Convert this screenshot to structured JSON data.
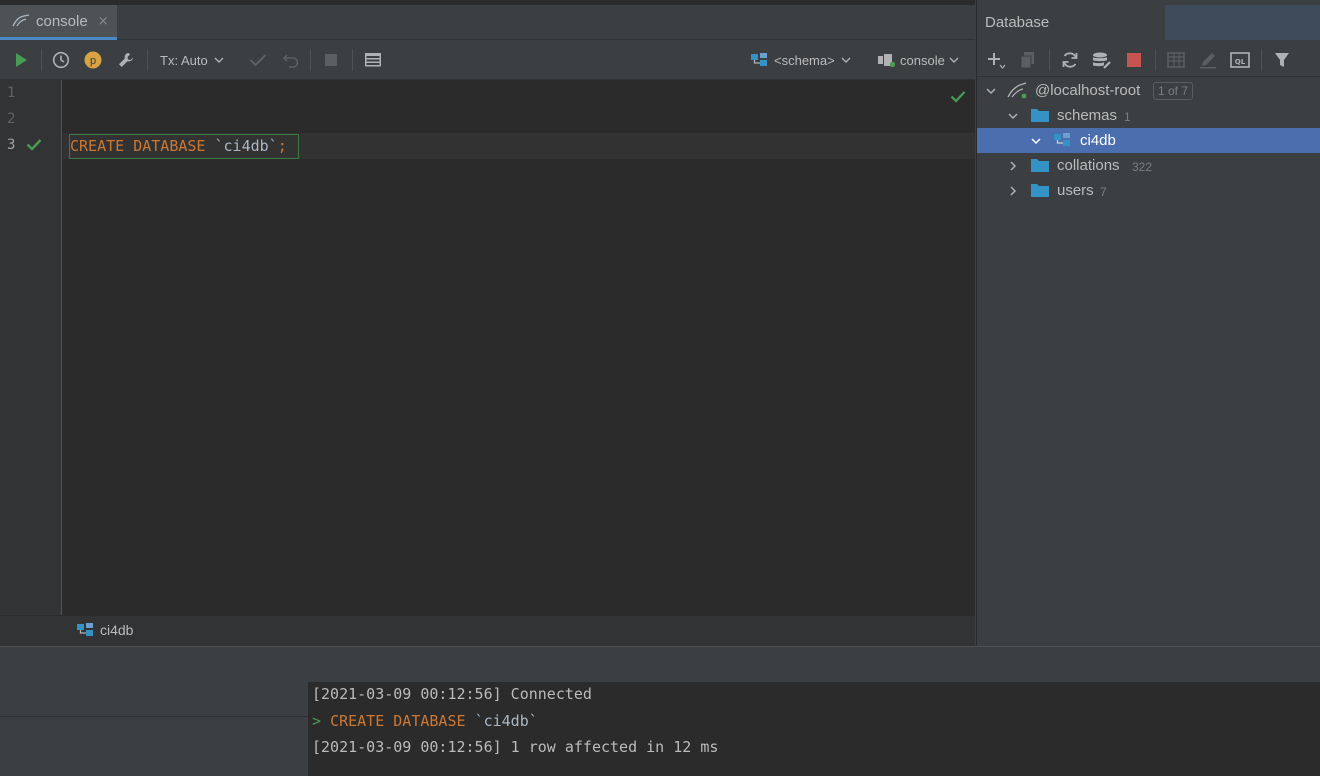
{
  "editor": {
    "tab": {
      "label": "console",
      "close": "×"
    },
    "toolbar": {
      "tx_label": "Tx: Auto",
      "schema_selector": "<schema>",
      "session_selector": "console"
    },
    "lines": [
      {
        "number": "1",
        "text": ""
      },
      {
        "number": "2",
        "text": ""
      },
      {
        "number": "3",
        "keyword": "CREATE DATABASE",
        "identifier": "`ci4db`",
        "terminator": ";"
      }
    ],
    "status_context": "ci4db"
  },
  "database_panel": {
    "title": "Database",
    "tree": {
      "root": {
        "label": "@localhost-root",
        "badge": "1 of 7"
      },
      "schemas": {
        "label": "schemas",
        "count": "1"
      },
      "schema_item": {
        "label": "ci4db"
      },
      "collations": {
        "label": "collations",
        "count": "322"
      },
      "users": {
        "label": "users",
        "count": "7"
      }
    }
  },
  "output": {
    "lines": [
      {
        "text": "[2021-03-09 00:12:56] Connected"
      },
      {
        "prompt": ">",
        "keyword": "CREATE DATABASE",
        "identifier": "`ci4db`"
      },
      {
        "text": "[2021-03-09 00:12:56] 1 row affected in 12 ms"
      }
    ]
  },
  "colors": {
    "accent_selection": "#4b6eaf",
    "keyword": "#cc7832",
    "run_green": "#499c54",
    "stop_red": "#c75450",
    "folder_blue": "#3592c4"
  }
}
